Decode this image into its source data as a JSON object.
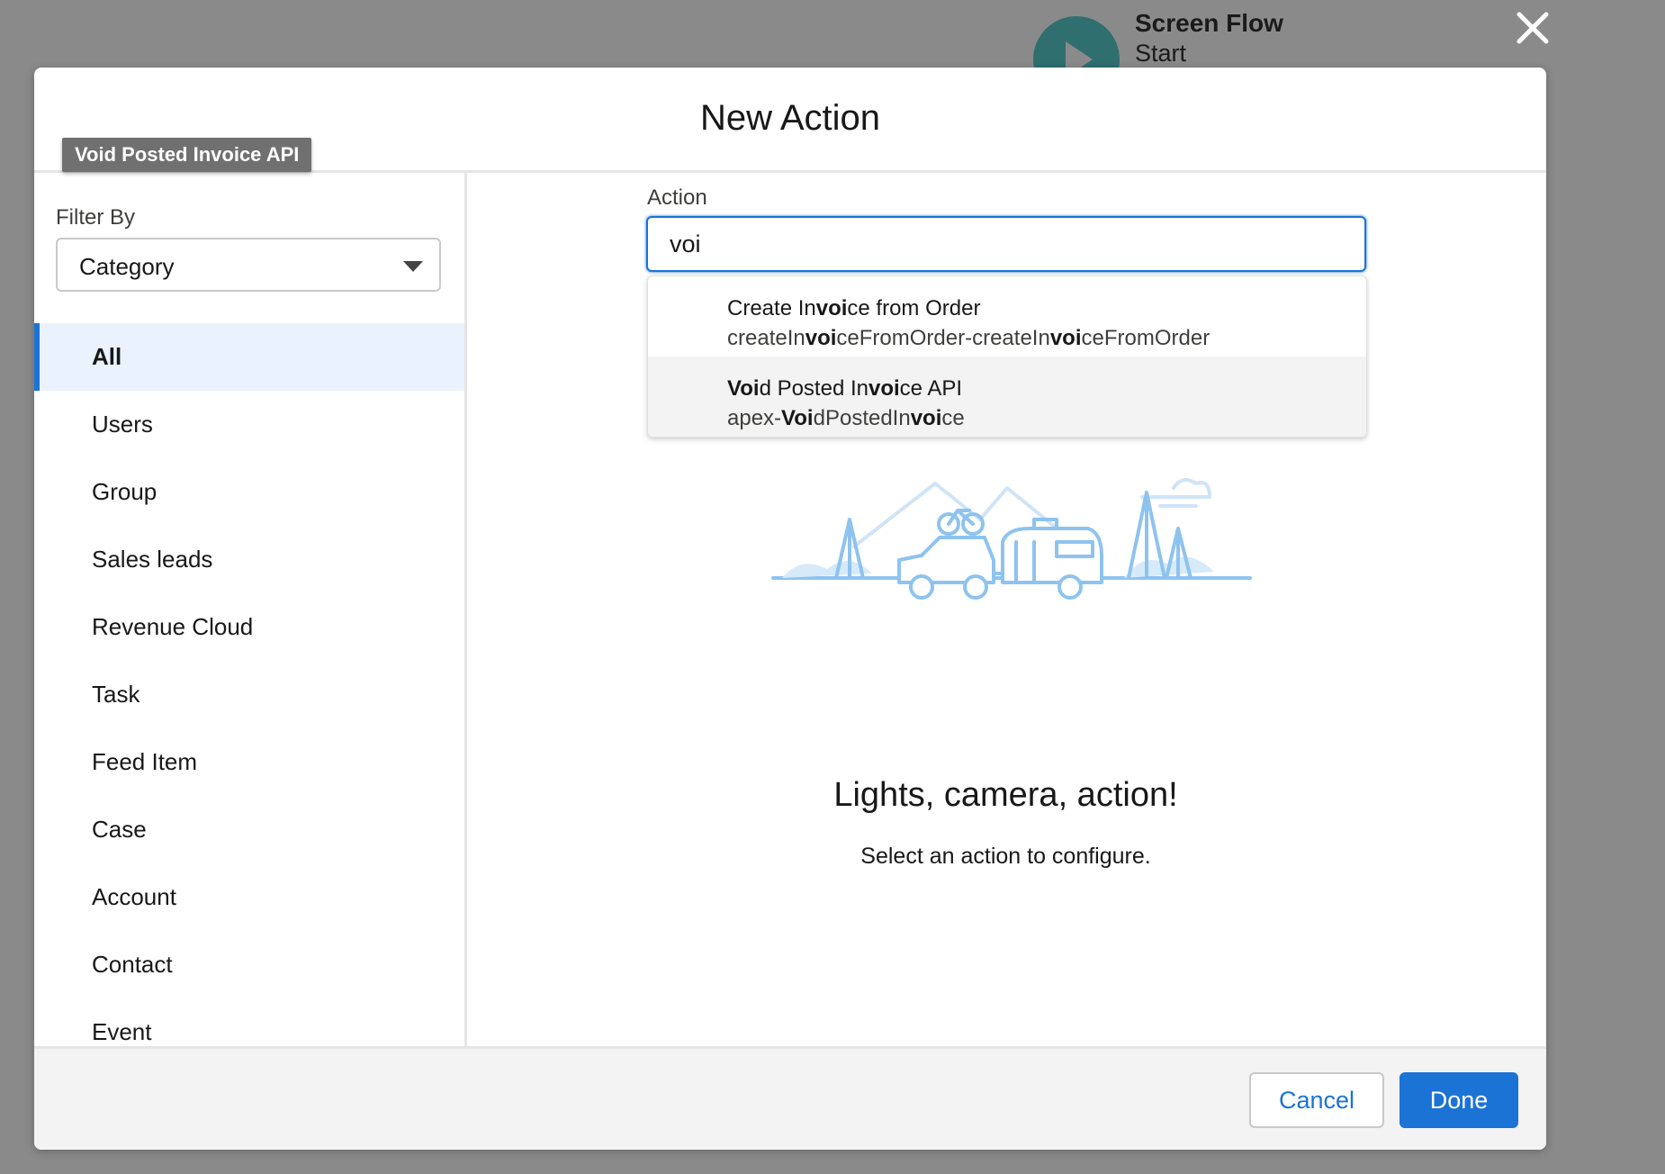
{
  "background": {
    "node_title": "Screen Flow",
    "node_subtitle": "Start"
  },
  "modal": {
    "title": "New Action",
    "tooltip": "Void Posted Invoice API",
    "filter": {
      "label": "Filter By",
      "selected": "Category"
    },
    "categories": [
      {
        "label": "All",
        "active": true
      },
      {
        "label": "Users"
      },
      {
        "label": "Group"
      },
      {
        "label": "Sales leads"
      },
      {
        "label": "Revenue Cloud"
      },
      {
        "label": "Task"
      },
      {
        "label": "Feed Item"
      },
      {
        "label": "Case"
      },
      {
        "label": "Account"
      },
      {
        "label": "Contact"
      },
      {
        "label": "Event"
      }
    ],
    "action": {
      "label": "Action",
      "value": "voi",
      "options": [
        {
          "title": "Create Invoice from Order",
          "subtitle": "createInvoiceFromOrder-createInvoiceFromOrder"
        },
        {
          "title": "Void Posted Invoice API",
          "subtitle": "apex-VoidPostedInvoice",
          "highlighted": true
        }
      ]
    },
    "empty_state": {
      "title": "Lights, camera, action!",
      "subtitle": "Select an action to configure."
    },
    "footer": {
      "cancel_label": "Cancel",
      "done_label": "Done"
    }
  },
  "colors": {
    "brand": "#1b73d6",
    "overlay": "#8a8a8a",
    "node": "#2f6f70",
    "illustration": "#8ec3ef"
  },
  "icons": [
    "play-icon",
    "close-icon",
    "chevron-down-icon",
    "camping-illustration"
  ]
}
